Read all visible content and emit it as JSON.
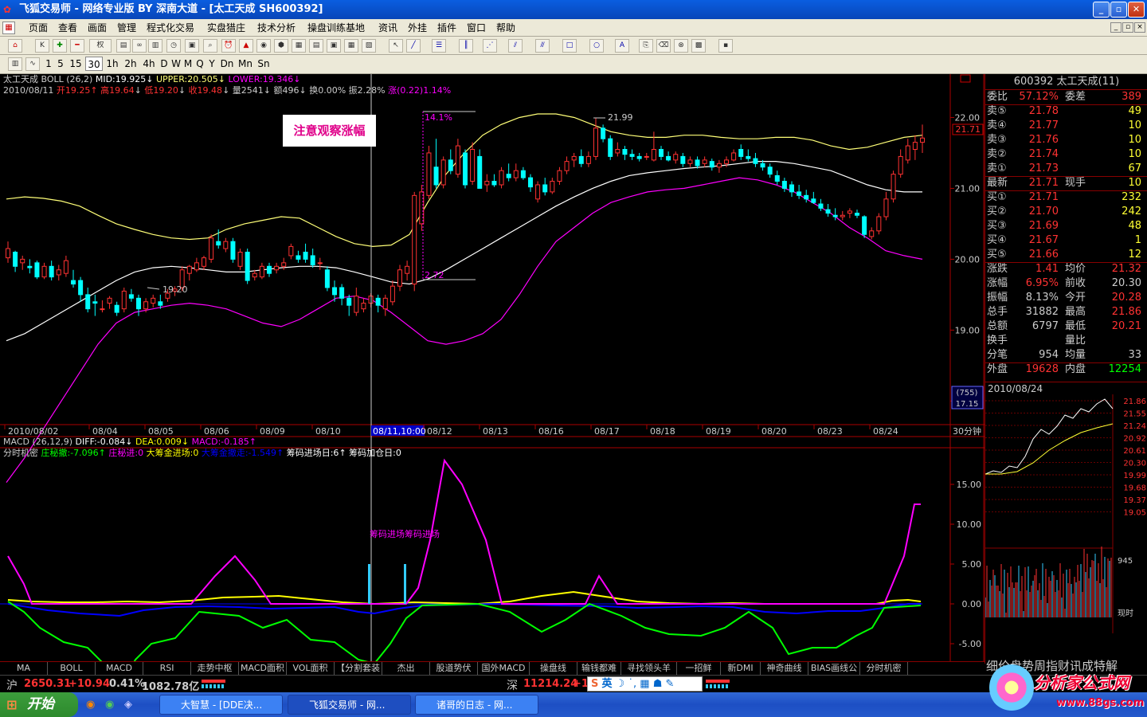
{
  "title": {
    "app": "飞狐交易师",
    "text": "飞狐交易师 - 网络专业版 BY 深南大道 - [太工天成 SH600392]"
  },
  "window_controls": {
    "min": "_",
    "max": "▫",
    "close": "✕"
  },
  "menu": [
    "页面",
    "查看",
    "画面",
    "管理",
    "程式化交易",
    "实盘猎庄",
    "技术分析",
    "操盘训练基地",
    "资讯",
    "外挂",
    "插件",
    "窗口",
    "帮助"
  ],
  "mdi_controls": {
    "min": "_",
    "restore": "▫",
    "close": "×"
  },
  "toolbar1": {
    "dropdown": "权"
  },
  "periods": [
    "1",
    "5",
    "15",
    "30",
    "1h",
    "2h",
    "4h",
    "D",
    "W",
    "M",
    "Q",
    "Y",
    "Dn",
    "Mn",
    "Sn"
  ],
  "selected_period": "30",
  "main_indicator": {
    "name": "太工天成",
    "formula": "BOLL (26,2)",
    "mid": "MID:19.925",
    "upper": "UPPER:20.505",
    "lower": "LOWER:19.346"
  },
  "quote_line": {
    "date": "2010/08/11",
    "open": "开19.25",
    "high": "高19.64",
    "low": "低19.20",
    "close": "收19.48",
    "vol": "量2541",
    "amt": "额496",
    "turn": "换0.00%",
    "amp": "振2.28%",
    "chg": "涨(0.22)1.14%"
  },
  "annotation": "注意观察涨幅",
  "price_labels": {
    "pct_top": "14.1%",
    "pct_bot": "2.72",
    "high": "21.99",
    "low": "19.20",
    "current": "21.71"
  },
  "y_axis": [
    "22.00",
    "21.00",
    "20.00",
    "19.00",
    "18.00"
  ],
  "crosshair_label": "08/11,10:00",
  "x_axis": [
    "2010/08/02",
    "08/04",
    "08/05",
    "08/06",
    "08/09",
    "08/10",
    "08/12",
    "08/13",
    "08/16",
    "08/17",
    "08/18",
    "08/19",
    "08/20",
    "08/23",
    "08/24"
  ],
  "info_box": {
    "count": "(755)",
    "value": "17.15"
  },
  "period_label": "30分钟",
  "macd_line": {
    "name": "MACD (26,12,9)",
    "diff": "DIFF:-0.084",
    "dea": "DEA:0.009",
    "macd": "MACD:-0.185"
  },
  "sub_indicator": {
    "name": "分时机密",
    "a": "庄秘撤:-7.096",
    "b": "庄秘进:0",
    "c": "大筹金进场:0",
    "d": "大筹金撤走:-1.549",
    "e": "筹码进场日:6",
    "f": "筹码加仓日:0"
  },
  "sub_annotation": "筹码进场筹码进场",
  "sub_y_axis": [
    "15.00",
    "10.00",
    "5.00",
    "0.00",
    "-5.00"
  ],
  "tabs": [
    "MA",
    "BOLL",
    "MACD",
    "RSI",
    "走势中枢",
    "MACD面积",
    "VOL面积",
    "【分割套装",
    "杰出",
    "股道势伏",
    "国外MACD",
    "操盘线",
    "输钱都难",
    "寻找领头羊",
    "一招鲜",
    "新DMI",
    "神奇曲线",
    "BIAS画线公",
    "分时机密"
  ],
  "stock_panel": {
    "header": "600392 太工天成(11)",
    "weibi_label": "委比",
    "weibi": "57.12%",
    "weicha_label": "委差",
    "weicha": "389",
    "asks": [
      {
        "l": "卖⑤",
        "p": "21.78",
        "v": "49"
      },
      {
        "l": "卖④",
        "p": "21.77",
        "v": "10"
      },
      {
        "l": "卖③",
        "p": "21.76",
        "v": "10"
      },
      {
        "l": "卖②",
        "p": "21.74",
        "v": "10"
      },
      {
        "l": "卖①",
        "p": "21.73",
        "v": "67"
      }
    ],
    "last": {
      "l": "最新",
      "p": "21.71",
      "l2": "现手",
      "v": "10"
    },
    "bids": [
      {
        "l": "买①",
        "p": "21.71",
        "v": "232"
      },
      {
        "l": "买②",
        "p": "21.70",
        "v": "242"
      },
      {
        "l": "买③",
        "p": "21.69",
        "v": "48"
      },
      {
        "l": "买④",
        "p": "21.67",
        "v": "1"
      },
      {
        "l": "买⑤",
        "p": "21.66",
        "v": "12"
      }
    ],
    "stats": [
      {
        "l1": "涨跌",
        "v1": "1.41",
        "l2": "均价",
        "v2": "21.32"
      },
      {
        "l1": "涨幅",
        "v1": "6.95%",
        "l2": "前收",
        "v2": "20.30"
      },
      {
        "l1": "振幅",
        "v1": "8.13%",
        "l2": "今开",
        "v2": "20.28"
      },
      {
        "l1": "总手",
        "v1": "31882",
        "l2": "最高",
        "v2": "21.86"
      },
      {
        "l1": "总额",
        "v1": "6797",
        "l2": "最低",
        "v2": "20.21"
      },
      {
        "l1": "换手",
        "v1": "",
        "l2": "量比",
        "v2": ""
      },
      {
        "l1": "分笔",
        "v1": "954",
        "l2": "均量",
        "v2": "33"
      }
    ],
    "outer": {
      "l": "外盘",
      "v": "19628",
      "l2": "内盘",
      "v2": "12254"
    },
    "date": "2010/08/24",
    "mini_y": [
      "21.86",
      "21.55",
      "21.24",
      "20.92",
      "20.61",
      "20.30",
      "19.99",
      "19.68",
      "19.37",
      "19.05"
    ],
    "mini_vol": "945",
    "mini_tag": "现时",
    "bottom_tabs": "细价盘势周指财讯成特解"
  },
  "statusbar": {
    "sh_label": "沪",
    "sh_idx": "2650.31",
    "sh_chg": "+10.94",
    "sh_pct": "0.41%",
    "sh_amt": "1082.78亿",
    "sz_label": "深",
    "sz_idx": "11214.24",
    "sz_chg": "+1",
    "ime": "英"
  },
  "taskbar": {
    "start": "开始",
    "tasks": [
      "大智慧 - [DDE决...",
      "飞狐交易师 - 网...",
      "诸哥的日志 - 网..."
    ],
    "watermark": "分析家公式网",
    "watermark_url": "www.88gs.com"
  },
  "colors": {
    "up": "#ff3232",
    "down": "#00ffff",
    "upper": "#ffff78",
    "mid": "#ffffff",
    "lower": "#ff00ff",
    "green": "#00ff00",
    "blue": "#0000ff",
    "yellow": "#ffff00",
    "axis": "#aa0000"
  },
  "chart_data": {
    "type": "candlestick",
    "ylim": [
      17.7,
      22.5
    ],
    "candles": [
      [
        20.02,
        20.25,
        19.95,
        20.15
      ],
      [
        20.1,
        20.12,
        19.82,
        19.9
      ],
      [
        19.95,
        20.05,
        19.85,
        20.0
      ],
      [
        19.9,
        20.0,
        19.8,
        19.88
      ],
      [
        19.95,
        19.98,
        19.72,
        19.75
      ],
      [
        19.75,
        19.95,
        19.72,
        19.9
      ],
      [
        19.9,
        19.98,
        19.7,
        19.75
      ],
      [
        19.78,
        19.92,
        19.7,
        19.85
      ],
      [
        19.8,
        20.05,
        19.75,
        19.98
      ],
      [
        19.7,
        19.85,
        19.6,
        19.65
      ],
      [
        19.7,
        19.75,
        19.4,
        19.5
      ],
      [
        19.5,
        19.6,
        19.25,
        19.3
      ],
      [
        19.4,
        19.5,
        19.2,
        19.38
      ],
      [
        19.3,
        19.42,
        19.25,
        19.3
      ],
      [
        19.38,
        19.48,
        19.3,
        19.45
      ],
      [
        19.35,
        19.4,
        19.2,
        19.25
      ],
      [
        19.3,
        19.6,
        19.25,
        19.55
      ],
      [
        19.5,
        19.58,
        19.4,
        19.45
      ],
      [
        19.45,
        19.5,
        19.2,
        19.3
      ],
      [
        19.3,
        19.45,
        19.25,
        19.4
      ],
      [
        19.38,
        19.5,
        19.32,
        19.45
      ],
      [
        19.4,
        19.5,
        19.3,
        19.35
      ],
      [
        19.45,
        19.58,
        19.4,
        19.52
      ],
      [
        19.55,
        19.62,
        19.48,
        19.58
      ],
      [
        19.6,
        19.9,
        19.55,
        19.85
      ],
      [
        19.8,
        19.92,
        19.7,
        19.9
      ],
      [
        19.85,
        20.02,
        19.82,
        19.95
      ],
      [
        19.9,
        20.05,
        19.85,
        20.02
      ],
      [
        20.0,
        20.35,
        19.95,
        20.3
      ],
      [
        20.25,
        20.42,
        20.15,
        20.2
      ],
      [
        20.15,
        20.3,
        20.1,
        20.25
      ],
      [
        20.25,
        20.3,
        19.95,
        20.0
      ],
      [
        19.9,
        20.15,
        19.85,
        20.1
      ],
      [
        20.1,
        20.15,
        19.65,
        19.7
      ],
      [
        19.75,
        19.85,
        19.7,
        19.8
      ],
      [
        19.75,
        19.95,
        19.72,
        19.9
      ],
      [
        19.9,
        19.95,
        19.75,
        19.8
      ],
      [
        19.85,
        19.95,
        19.8,
        19.9
      ],
      [
        19.9,
        20.02,
        19.85,
        19.95
      ],
      [
        20.05,
        20.22,
        20.0,
        20.18
      ],
      [
        20.05,
        20.12,
        19.95,
        20.0
      ],
      [
        20.1,
        20.22,
        19.95,
        20.0
      ],
      [
        20.05,
        20.15,
        19.88,
        19.92
      ],
      [
        19.95,
        20.02,
        19.85,
        19.95
      ],
      [
        19.85,
        19.9,
        19.55,
        19.6
      ],
      [
        19.6,
        19.7,
        19.4,
        19.5
      ],
      [
        19.6,
        19.65,
        19.35,
        19.45
      ],
      [
        19.45,
        19.5,
        19.2,
        19.35
      ],
      [
        19.25,
        19.6,
        19.2,
        19.48
      ],
      [
        19.3,
        19.45,
        19.25,
        19.38
      ],
      [
        19.38,
        19.52,
        19.32,
        19.48
      ],
      [
        19.45,
        19.5,
        19.25,
        19.35
      ],
      [
        19.3,
        19.5,
        19.2,
        19.45
      ],
      [
        19.4,
        19.7,
        19.35,
        19.62
      ],
      [
        19.62,
        19.92,
        19.55,
        19.85
      ],
      [
        19.8,
        19.98,
        19.7,
        19.9
      ],
      [
        19.65,
        20.95,
        19.55,
        20.9
      ],
      [
        20.5,
        21.05,
        20.4,
        20.95
      ],
      [
        20.9,
        21.6,
        20.85,
        21.5
      ],
      [
        21.3,
        21.7,
        21.0,
        21.05
      ],
      [
        21.05,
        21.45,
        21.0,
        21.4
      ],
      [
        21.4,
        21.55,
        21.2,
        21.25
      ],
      [
        21.2,
        21.7,
        21.15,
        21.6
      ],
      [
        21.5,
        21.55,
        21.0,
        21.05
      ],
      [
        21.1,
        21.65,
        21.05,
        21.55
      ],
      [
        21.45,
        21.55,
        21.0,
        21.0
      ],
      [
        21.05,
        21.2,
        20.95,
        21.1
      ],
      [
        21.1,
        21.2,
        21.02,
        21.05
      ],
      [
        21.05,
        21.3,
        21.0,
        21.25
      ],
      [
        21.2,
        21.35,
        21.1,
        21.15
      ],
      [
        21.15,
        21.35,
        21.1,
        21.25
      ],
      [
        21.25,
        21.3,
        21.12,
        21.15
      ],
      [
        21.15,
        21.2,
        20.95,
        21.02
      ],
      [
        20.85,
        21.1,
        20.8,
        21.05
      ],
      [
        21.05,
        21.15,
        20.9,
        20.95
      ],
      [
        20.95,
        21.15,
        20.92,
        21.1
      ],
      [
        21.1,
        21.3,
        21.05,
        21.25
      ],
      [
        21.25,
        21.45,
        21.2,
        21.38
      ],
      [
        21.4,
        21.5,
        21.3,
        21.45
      ],
      [
        21.45,
        21.55,
        21.3,
        21.35
      ],
      [
        21.35,
        21.52,
        21.3,
        21.45
      ],
      [
        21.45,
        21.99,
        21.4,
        21.85
      ],
      [
        21.85,
        21.9,
        21.65,
        21.7
      ],
      [
        21.7,
        21.75,
        21.4,
        21.45
      ],
      [
        21.5,
        21.65,
        21.45,
        21.55
      ],
      [
        21.55,
        21.6,
        21.4,
        21.48
      ],
      [
        21.48,
        21.55,
        21.4,
        21.45
      ],
      [
        21.45,
        21.5,
        21.38,
        21.42
      ],
      [
        21.45,
        21.5,
        21.4,
        21.45
      ],
      [
        21.4,
        21.8,
        21.38,
        21.55
      ],
      [
        21.55,
        21.6,
        21.4,
        21.45
      ],
      [
        21.45,
        21.52,
        21.38,
        21.4
      ],
      [
        21.4,
        21.52,
        21.35,
        21.48
      ],
      [
        21.45,
        21.5,
        21.3,
        21.35
      ],
      [
        21.35,
        21.45,
        21.3,
        21.4
      ],
      [
        21.4,
        21.45,
        21.28,
        21.32
      ],
      [
        21.35,
        21.45,
        21.3,
        21.4
      ],
      [
        21.38,
        21.42,
        21.25,
        21.3
      ],
      [
        21.3,
        21.4,
        21.22,
        21.35
      ],
      [
        21.35,
        21.45,
        21.3,
        21.4
      ],
      [
        21.4,
        21.55,
        21.38,
        21.5
      ],
      [
        21.55,
        21.62,
        21.4,
        21.45
      ],
      [
        21.45,
        21.55,
        21.38,
        21.42
      ],
      [
        21.42,
        21.5,
        21.3,
        21.35
      ],
      [
        21.35,
        21.4,
        21.25,
        21.3
      ],
      [
        21.3,
        21.35,
        21.15,
        21.2
      ],
      [
        21.18,
        21.25,
        21.05,
        21.1
      ],
      [
        21.1,
        21.15,
        20.95,
        21.0
      ],
      [
        21.05,
        21.1,
        20.88,
        20.95
      ],
      [
        20.95,
        21.05,
        20.85,
        20.9
      ],
      [
        20.9,
        20.98,
        20.8,
        20.85
      ],
      [
        20.85,
        20.95,
        20.78,
        20.8
      ],
      [
        20.78,
        20.85,
        20.68,
        20.72
      ],
      [
        20.7,
        20.78,
        20.6,
        20.65
      ],
      [
        20.62,
        20.72,
        20.55,
        20.6
      ],
      [
        20.6,
        20.68,
        20.55,
        20.62
      ],
      [
        20.65,
        20.72,
        20.58,
        20.68
      ],
      [
        20.65,
        20.7,
        20.58,
        20.62
      ],
      [
        20.6,
        20.62,
        20.3,
        20.35
      ],
      [
        20.32,
        20.45,
        20.28,
        20.4
      ],
      [
        20.4,
        20.65,
        20.35,
        20.6
      ],
      [
        20.6,
        20.95,
        20.55,
        20.85
      ],
      [
        20.85,
        21.25,
        20.8,
        21.2
      ],
      [
        21.2,
        21.55,
        21.15,
        21.45
      ],
      [
        21.4,
        21.7,
        21.35,
        21.6
      ],
      [
        21.55,
        21.75,
        21.4,
        21.65
      ],
      [
        21.65,
        21.9,
        21.5,
        21.71
      ]
    ],
    "upper": [
      20.85,
      20.88,
      20.86,
      20.82,
      20.75,
      20.62,
      20.5,
      20.42,
      20.35,
      20.3,
      20.28,
      20.3,
      20.42,
      20.5,
      20.55,
      20.6,
      20.58,
      20.45,
      20.32,
      20.22,
      20.18,
      20.2,
      20.35,
      20.8,
      21.2,
      21.5,
      21.75,
      21.9,
      22.0,
      22.05,
      22.05,
      22.0,
      21.9,
      21.8,
      21.75,
      21.72,
      21.72,
      21.75,
      21.75,
      21.72,
      21.7,
      21.7,
      21.72,
      21.72,
      21.68,
      21.6,
      21.55,
      21.58,
      21.65,
      21.72,
      21.75
    ],
    "mid": [
      18.85,
      18.95,
      19.1,
      19.25,
      19.4,
      19.55,
      19.7,
      19.82,
      19.88,
      19.9,
      19.88,
      19.85,
      19.82,
      19.82,
      19.85,
      19.88,
      19.9,
      19.9,
      19.88,
      19.82,
      19.75,
      19.68,
      19.65,
      19.72,
      19.85,
      20.0,
      20.15,
      20.3,
      20.45,
      20.6,
      20.75,
      20.88,
      21.0,
      21.1,
      21.18,
      21.22,
      21.25,
      21.28,
      21.3,
      21.32,
      21.35,
      21.38,
      21.38,
      21.35,
      21.3,
      21.25,
      21.15,
      21.05,
      20.98,
      20.95,
      20.95
    ],
    "lower": [
      16.85,
      17.2,
      17.6,
      18.0,
      18.4,
      18.8,
      19.1,
      19.25,
      19.3,
      19.35,
      19.38,
      19.35,
      19.3,
      19.2,
      19.1,
      19.05,
      19.15,
      19.3,
      19.45,
      19.48,
      19.42,
      19.25,
      19.05,
      18.85,
      18.8,
      18.85,
      18.95,
      19.15,
      19.5,
      19.9,
      20.25,
      20.45,
      20.65,
      20.8,
      20.88,
      20.95,
      20.98,
      21.0,
      21.05,
      21.1,
      21.15,
      21.12,
      21.05,
      20.95,
      20.8,
      20.65,
      20.45,
      20.3,
      20.12,
      20.05,
      20.0
    ]
  }
}
